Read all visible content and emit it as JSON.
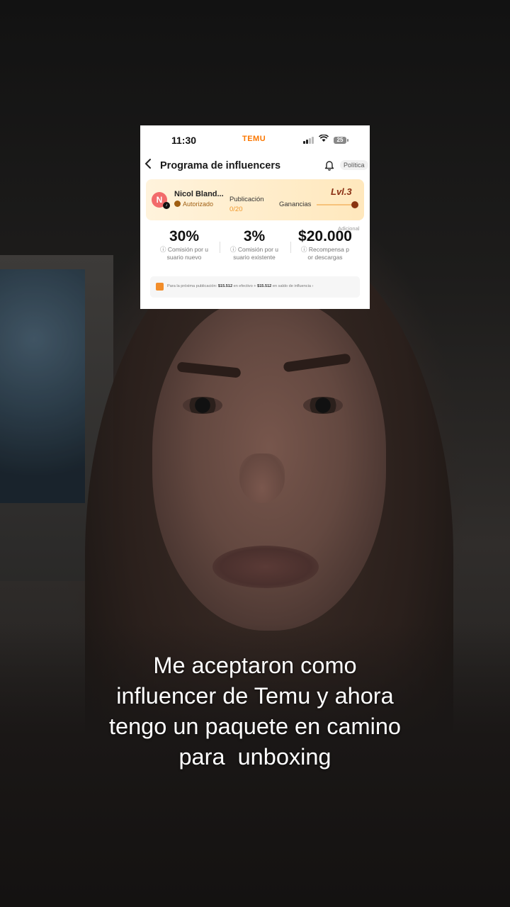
{
  "screenshot": {
    "status_bar": {
      "time": "11:30",
      "brand": "TEMU",
      "battery": "25"
    },
    "nav": {
      "back_icon": "chevron-left-icon",
      "title": "Programa de influencers",
      "bell_icon": "bell-icon",
      "policy_label": "Política"
    },
    "profile": {
      "avatar_letter": "N",
      "name": "Nicol Bland...",
      "status": "Autorizado",
      "publication_label": "Publicación",
      "publication_value": "0/20",
      "level": "Lvl.3",
      "earnings_label": "Ganancias"
    },
    "stats": {
      "extra_label": "Adicional",
      "items": [
        {
          "value": "30%",
          "line1": "ⓘ Comisión por u",
          "line2": "suario nuevo"
        },
        {
          "value": "3%",
          "line1": "ⓘ Comisión por u",
          "line2": "suario existente"
        },
        {
          "value": "$20.000",
          "line1": "ⓘ Recompensa p",
          "line2": "or descargas"
        }
      ]
    },
    "footer": {
      "pre": "Para la próxima publicación:",
      "amount1": "$15.512",
      "mid": "en efectivo +",
      "amount2": "$15.512",
      "post": "en saldo de influencia ›"
    }
  },
  "caption": {
    "line1": "Me aceptaron como",
    "line2": "influencer de Temu y ahora",
    "line3": "tengo un paquete en camino",
    "line4": "para  unboxing"
  },
  "colors": {
    "brand_orange": "#fb7701",
    "level_brown": "#8a2e12"
  }
}
